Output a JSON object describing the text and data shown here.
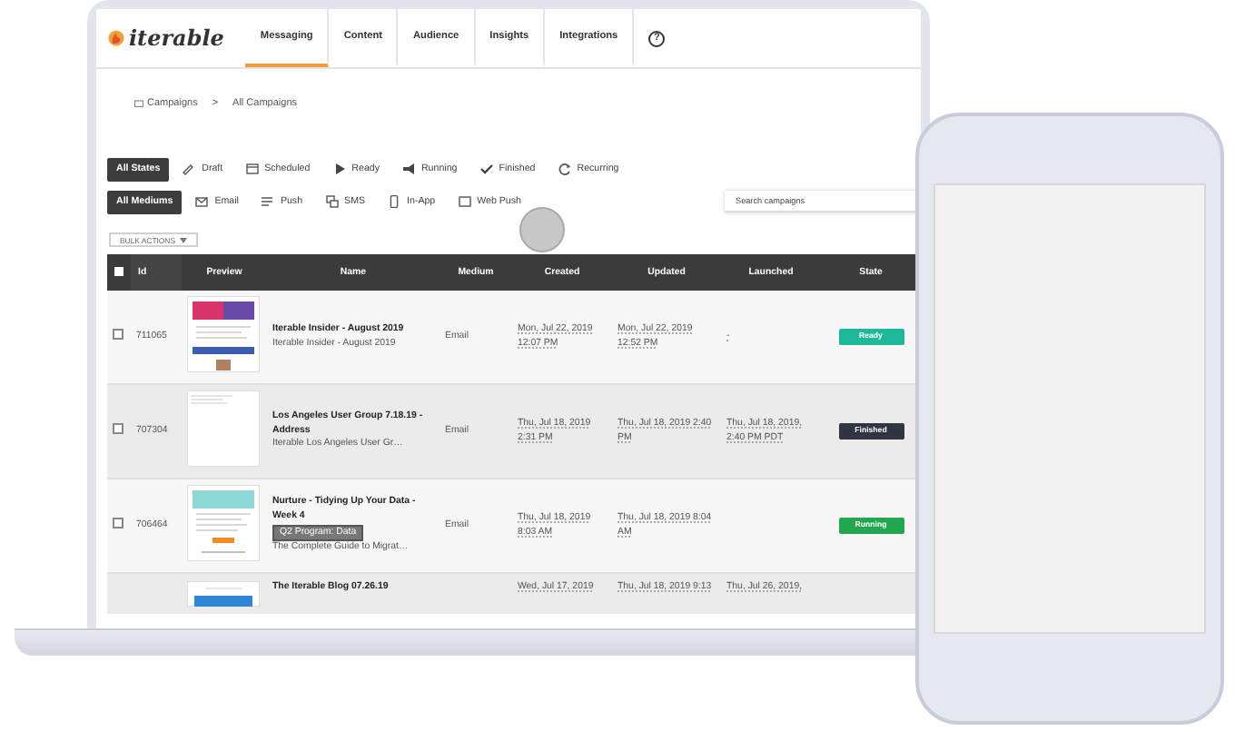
{
  "logo": "iterable",
  "nav": [
    {
      "label": "Messaging",
      "selected": true
    },
    {
      "label": "Content",
      "selected": false
    },
    {
      "label": "Audience",
      "selected": false
    },
    {
      "label": "Insights",
      "selected": false
    },
    {
      "label": "Integrations",
      "selected": false
    }
  ],
  "help": "?",
  "breadcrumb": [
    "Campaigns",
    "All Campaigns"
  ],
  "breadcrumb_separator": ">",
  "state_filters": [
    {
      "label": "All States",
      "selected": true
    },
    {
      "label": "Draft",
      "selected": false
    },
    {
      "label": "Scheduled",
      "selected": false
    },
    {
      "label": "Ready",
      "selected": false
    },
    {
      "label": "Running",
      "selected": false
    },
    {
      "label": "Finished",
      "selected": false
    },
    {
      "label": "Recurring",
      "selected": false
    }
  ],
  "medium_filters": [
    {
      "label": "All Mediums",
      "selected": true
    },
    {
      "label": "Email",
      "selected": false
    },
    {
      "label": "Push",
      "selected": false
    },
    {
      "label": "SMS",
      "selected": false
    },
    {
      "label": "In-App",
      "selected": false
    },
    {
      "label": "Web Push",
      "selected": false
    }
  ],
  "search": {
    "placeholder": "Search campaigns"
  },
  "bulk_actions": "BULK ACTIONS",
  "select_all": {
    "checked": false
  },
  "columns": [
    "Id",
    "Preview",
    "Name",
    "Medium",
    "Created",
    "Updated",
    "Launched",
    "State"
  ],
  "rows": [
    {
      "checked": false,
      "id": "711065",
      "name": "Iterable Insider - August 2019",
      "subtitle": "Iterable Insider - August 2019",
      "medium": "Email",
      "created": "Mon, Jul 22, 2019 12:07 PM",
      "updated": "Mon, Jul 22, 2019 12:52 PM",
      "launched": "-",
      "state": {
        "label": "Ready",
        "color": "#1fb89a"
      }
    },
    {
      "checked": false,
      "id": "707304",
      "name": "Los Angeles User Group 7.18.19 - Address",
      "subtitle": "Iterable Los Angeles User Gr…",
      "medium": "Email",
      "created": "Thu, Jul 18, 2019 2:31 PM",
      "updated": "Thu, Jul 18, 2019 2:40 PM",
      "launched": "Thu, Jul 18, 2019, 2:40 PM PDT",
      "state": {
        "label": "Finished",
        "color": "#2f3542"
      }
    },
    {
      "checked": false,
      "id": "706464",
      "name": "Nurture - Tidying Up Your Data - Week 4",
      "tag": "Q2 Program: Data",
      "subtitle": "The Complete Guide to Migrat…",
      "medium": "Email",
      "created": "Thu, Jul 18, 2019 8:03 AM",
      "updated": "Thu, Jul 18, 2019 8:04 AM",
      "state": {
        "label": "Running",
        "color": "#22a650"
      }
    },
    {
      "name": "The Iterable Blog 07.26.19",
      "created": "Wed, Jul 17, 2019",
      "updated": "Thu, Jul 18, 2019 9:13",
      "launched": "Thu, Jul 26, 2019,"
    }
  ]
}
